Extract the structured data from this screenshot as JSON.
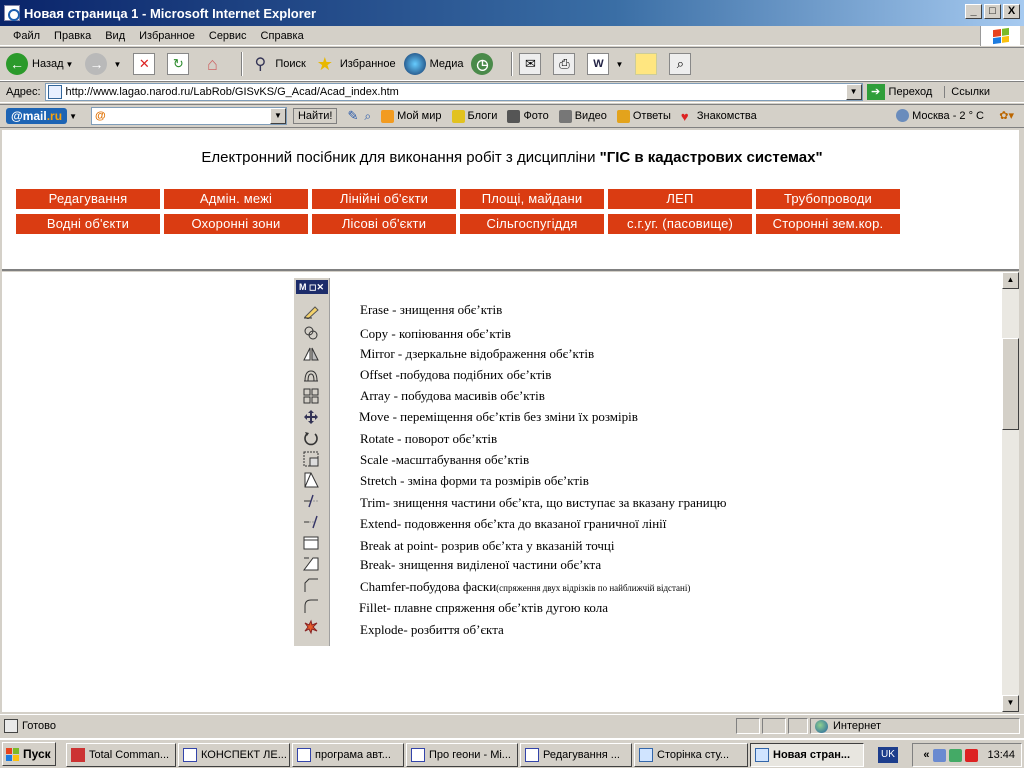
{
  "window": {
    "title": "Новая страница 1 - Microsoft Internet Explorer",
    "minimize": "_",
    "maximize": "□",
    "close": "X"
  },
  "menu": [
    "Файл",
    "Правка",
    "Вид",
    "Избранное",
    "Сервис",
    "Справка"
  ],
  "toolbar": {
    "back": "Назад",
    "search": "Поиск",
    "favorites": "Избранное",
    "media": "Медиа"
  },
  "address": {
    "label": "Адрес:",
    "url": "http://www.lagao.narod.ru/LabRob/GISvKS/G_Acad/Acad_index.htm",
    "go": "Переход",
    "links": "Ссылки"
  },
  "mailbar": {
    "logo_prefix": "@mail",
    "logo_suffix": ".ru",
    "search_value": "@",
    "find": "Найти!",
    "items": [
      "Мой мир",
      "Блоги",
      "Фото",
      "Видео",
      "Ответы",
      "Знакомства"
    ],
    "weather": "Москва - 2 ° C"
  },
  "header": {
    "heading_plain": "Електронний посібник для виконання робіт з дисципліни ",
    "heading_bold": "\"ГІС в кадастрових системах\"",
    "nav_row1": [
      "Редагування",
      "Адмін. межі",
      "Лінійні об'єкти",
      "Площі, майдани",
      "ЛЕП",
      "Трубопроводи"
    ],
    "nav_row2": [
      "Водні об'єкти",
      "Охоронні зони",
      "Лісові об'єкти",
      "Сільгоспугіддя",
      "с.г.уг. (пасовище)",
      "Сторонні зем.кор."
    ]
  },
  "palette": {
    "title": "M"
  },
  "commands": [
    {
      "text": "Erase - знищення обєʼктів",
      "icon": "eraser-icon"
    },
    {
      "text": "Copy - копіювання обєʼктів",
      "icon": "copy-icon"
    },
    {
      "text": "Mirror - дзеркальне відображення обєʼктів",
      "icon": "mirror-icon"
    },
    {
      "text": "Offset -побудова подібних обєʼктів",
      "icon": "offset-icon"
    },
    {
      "text": "Array - побудова масивів обєʼктів",
      "icon": "array-icon"
    },
    {
      "text": "Move - переміщення обєʼктів без зміни їх розмірів",
      "icon": "move-icon"
    },
    {
      "text": "Rotate - поворот обєʼктів",
      "icon": "rotate-icon"
    },
    {
      "text": "Scale -масштабування обєʼктів",
      "icon": "scale-icon"
    },
    {
      "text": "Stretch - зміна форми та розмірів обєʼктів",
      "icon": "stretch-icon"
    },
    {
      "text": "Trim- знищення частини обєʼкта, що виступає за вказану границю",
      "icon": "trim-icon"
    },
    {
      "text": "Extend- подовження обєʼкта до вказаної граничної лінії",
      "icon": "extend-icon"
    },
    {
      "text": "Break at point- розрив обєʼкта у вказаній точці",
      "icon": "break-at-point-icon"
    },
    {
      "text": "Break- знищення виділеної частини обєʼкта",
      "icon": "break-icon"
    },
    {
      "text": "Chamfer-побудова фаски",
      "note": "(спряження двух відрізків по найближчій відстані)",
      "icon": "chamfer-icon"
    },
    {
      "text": "Fillet- плавне спряження обєʼктів дугою кола",
      "icon": "fillet-icon"
    },
    {
      "text": "Explode- розбиття обʼєкта",
      "icon": "explode-icon"
    }
  ],
  "status": {
    "text": "Готово",
    "zone": "Интернет"
  },
  "taskbar": {
    "start": "Пуск",
    "tasks": [
      "Total Comman...",
      "КОНСПЕКТ ЛЕ...",
      "програма авт...",
      "Про геони - Mi...",
      "Редагування ...",
      "Сторінка сту...",
      "Новая стран..."
    ],
    "lang": "UK",
    "chevron": "«",
    "time": "13:44"
  },
  "colors": {
    "nav_button": "#da3c12",
    "title_bar": "#0a246a"
  }
}
